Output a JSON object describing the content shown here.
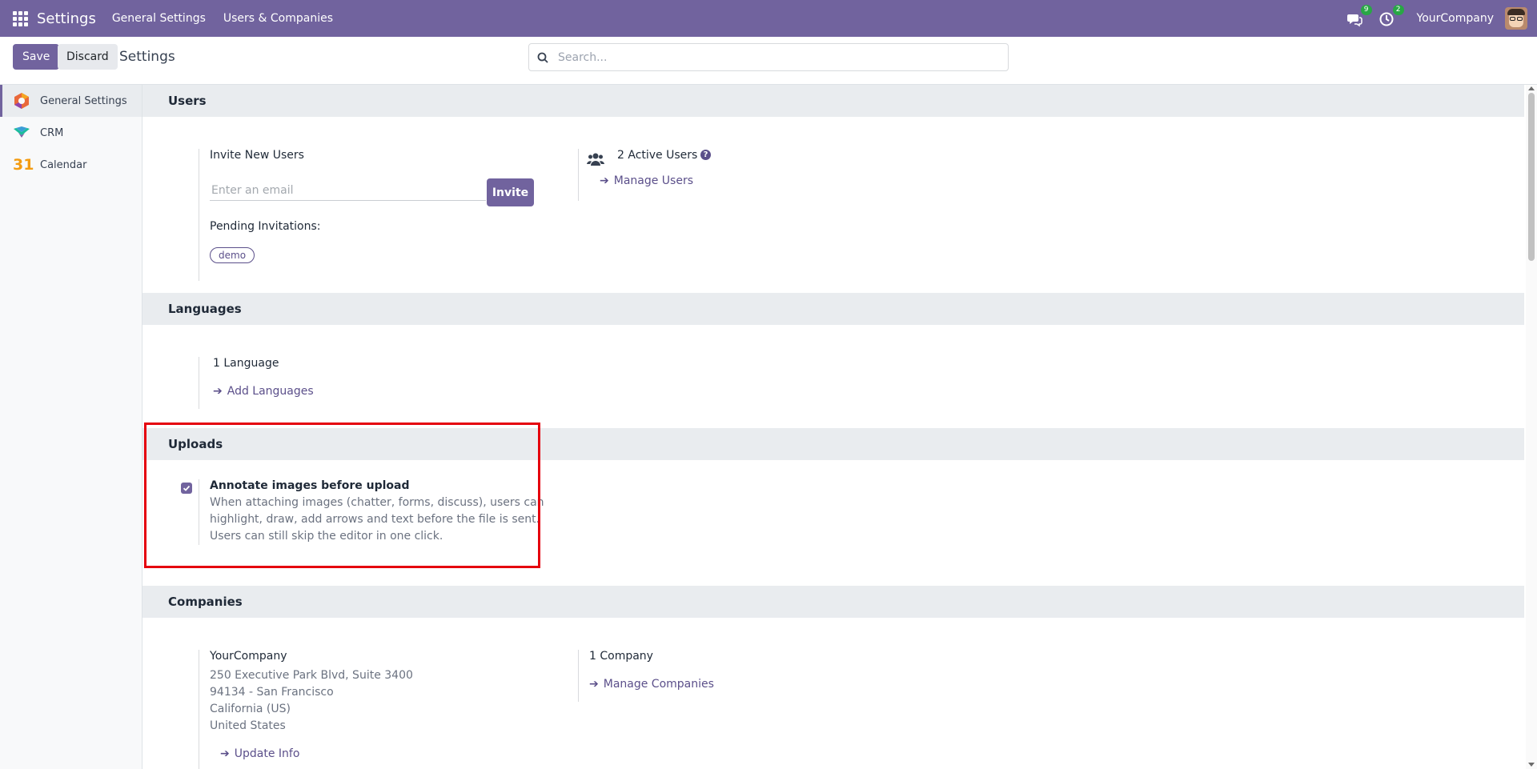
{
  "navbar": {
    "app_title": "Settings",
    "menu": [
      "General Settings",
      "Users & Companies"
    ],
    "messages_badge": "9",
    "activity_badge": "2",
    "company": "YourCompany"
  },
  "control_panel": {
    "save_label": "Save",
    "discard_label": "Discard",
    "breadcrumb": "Settings",
    "search_placeholder": "Search..."
  },
  "sidebar": {
    "items": [
      {
        "label": "General Settings",
        "icon": "settings-app-icon",
        "active": true
      },
      {
        "label": "CRM",
        "icon": "crm-app-icon"
      },
      {
        "label": "Calendar",
        "icon": "calendar-app-icon",
        "icon_text": "31"
      }
    ]
  },
  "users": {
    "title": "Users",
    "invite_label": "Invite New Users",
    "email_placeholder": "Enter an email",
    "invite_button": "Invite",
    "pending_label": "Pending Invitations:",
    "pending_tags": [
      "demo"
    ],
    "active_users": "2 Active Users",
    "manage_users": "Manage Users"
  },
  "languages": {
    "title": "Languages",
    "count": "1 Language",
    "add_link": "Add Languages"
  },
  "uploads": {
    "title": "Uploads",
    "annotate_label": "Annotate images before upload",
    "annotate_desc_1": "When attaching images (chatter, forms, discuss), users can",
    "annotate_desc_2": "highlight, draw, add arrows and text before the file is sent.",
    "annotate_desc_3": "Users can still skip the editor in one click.",
    "annotate_checked": true
  },
  "companies": {
    "title": "Companies",
    "name": "YourCompany",
    "address_1": "250 Executive Park Blvd, Suite 3400",
    "address_2": "94134 - San Francisco",
    "address_3": "California (US)",
    "address_4": "United States",
    "update_link": "Update Info",
    "count": "1 Company",
    "manage_link": "Manage Companies"
  },
  "colors": {
    "brand": "#71639e",
    "highlight": "#e5000e",
    "section_bg": "#e9ecef"
  }
}
